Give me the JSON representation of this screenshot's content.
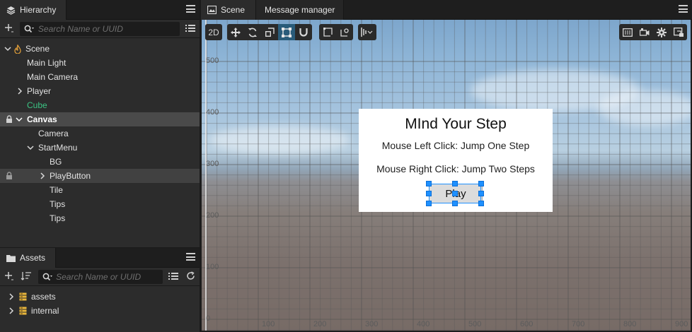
{
  "hierarchy": {
    "tab_label": "Hierarchy",
    "search_placeholder": "Search Name or UUID",
    "nodes": [
      {
        "label": "Scene"
      },
      {
        "label": "Main Light"
      },
      {
        "label": "Main Camera"
      },
      {
        "label": "Player"
      },
      {
        "label": "Cube"
      },
      {
        "label": "Canvas"
      },
      {
        "label": "Camera"
      },
      {
        "label": "StartMenu"
      },
      {
        "label": "BG"
      },
      {
        "label": "PlayButton"
      },
      {
        "label": "Tile"
      },
      {
        "label": "Tips"
      },
      {
        "label": "Tips"
      }
    ]
  },
  "assets": {
    "tab_label": "Assets",
    "search_placeholder": "Search Name or UUID",
    "items": [
      {
        "label": "assets"
      },
      {
        "label": "internal"
      }
    ]
  },
  "scene": {
    "tabs": [
      {
        "label": "Scene"
      },
      {
        "label": "Message manager"
      }
    ],
    "mode_label": "2D",
    "y_ticks": [
      "500",
      "400",
      "300",
      "200",
      "100",
      "0"
    ],
    "x_ticks": [
      "100",
      "200",
      "300",
      "400",
      "500",
      "600",
      "700",
      "800",
      "900"
    ],
    "dialog": {
      "title": "MInd Your Step",
      "line1": "Mouse Left Click: Jump One Step",
      "line2": "Mouse Right Click: Jump Two Steps",
      "play_label": "Play"
    }
  },
  "colors": {
    "accent": "#1e90ff",
    "green_node": "#3bc383",
    "panel": "#2c2c2c"
  }
}
